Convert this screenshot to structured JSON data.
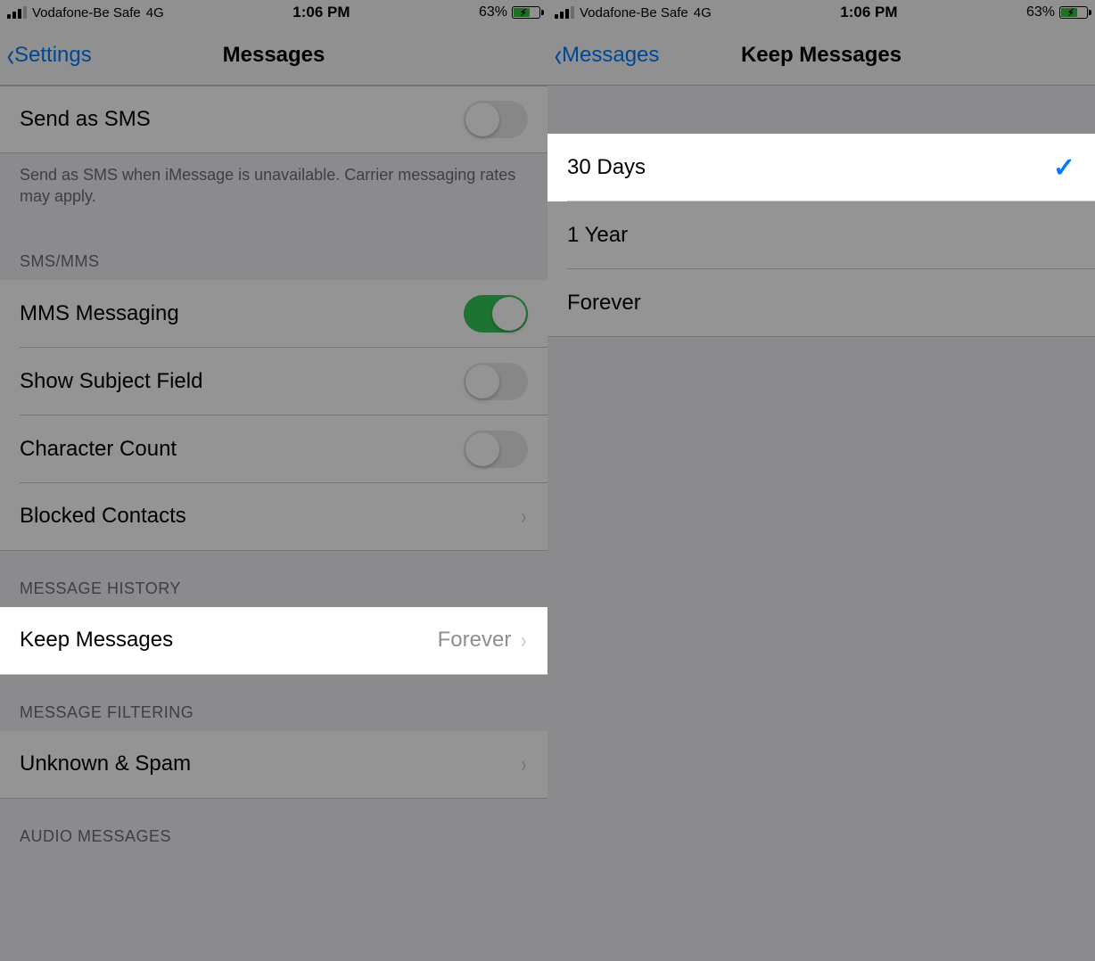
{
  "status": {
    "carrier": "Vodafone-Be Safe",
    "network": "4G",
    "time": "1:06 PM",
    "battery_pct": "63%"
  },
  "left": {
    "back": "Settings",
    "title": "Messages",
    "send_sms_label": "Send as SMS",
    "send_sms_on": false,
    "send_sms_footer": "Send as SMS when iMessage is unavailable. Carrier messaging rates may apply.",
    "section_smsmms": "SMS/MMS",
    "mms_label": "MMS Messaging",
    "mms_on": true,
    "subject_label": "Show Subject Field",
    "subject_on": false,
    "charcount_label": "Character Count",
    "charcount_on": false,
    "blocked_label": "Blocked Contacts",
    "section_history": "MESSAGE HISTORY",
    "keep_label": "Keep Messages",
    "keep_value": "Forever",
    "section_filtering": "MESSAGE FILTERING",
    "unknown_label": "Unknown & Spam",
    "section_audio": "AUDIO MESSAGES"
  },
  "right": {
    "back": "Messages",
    "title": "Keep Messages",
    "options": {
      "thirty": "30 Days",
      "year": "1 Year",
      "forever": "Forever"
    },
    "selected": "thirty"
  }
}
